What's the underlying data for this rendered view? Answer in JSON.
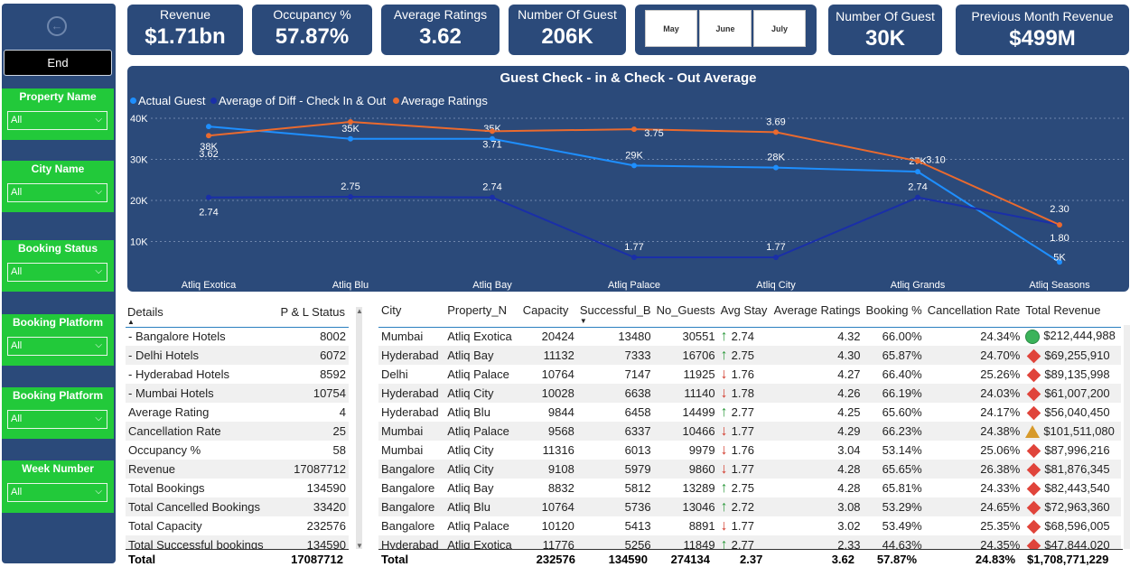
{
  "sidebar": {
    "end_label": "End",
    "slicers": [
      {
        "title": "Property Name",
        "value": "All"
      },
      {
        "title": "City Name",
        "value": "All"
      },
      {
        "title": "Booking Status",
        "value": "All"
      },
      {
        "title": "Booking Platform",
        "value": "All"
      },
      {
        "title": "Booking Platform",
        "value": "All"
      },
      {
        "title": "Week Number",
        "value": "All"
      }
    ]
  },
  "kpis": [
    {
      "label": "Revenue",
      "value": "$1.71bn"
    },
    {
      "label": "Occupancy %",
      "value": "57.87%"
    },
    {
      "label": "Average Ratings",
      "value": "3.62"
    },
    {
      "label": "Number Of Guest",
      "value": "206K"
    },
    {
      "label": "Number Of Guest",
      "value": "30K"
    },
    {
      "label": "Previous Month Revenue",
      "value": "$499M"
    }
  ],
  "months": [
    "May",
    "June",
    "July"
  ],
  "chart_data": {
    "type": "line",
    "title": "Guest Check - in & Check - Out Average",
    "categories": [
      "Atliq Exotica",
      "Atliq Blu",
      "Atliq Bay",
      "Atliq Palace",
      "Atliq City",
      "Atliq Grands",
      "Atliq Seasons"
    ],
    "y_ticks": [
      "40K",
      "30K",
      "20K",
      "10K"
    ],
    "ylim": [
      0,
      42000
    ],
    "series": [
      {
        "name": "Actual Guest",
        "color": "#1e8fff",
        "values": [
          38000,
          35000,
          35000,
          28500,
          28000,
          27000,
          5000
        ],
        "labels": [
          "38K",
          "35K",
          "35K",
          "29K",
          "28K",
          "27K",
          "5K"
        ]
      },
      {
        "name": "Average of Diff - Check In & Out",
        "color": "#1a2fa8",
        "values": [
          2.74,
          2.75,
          2.74,
          1.77,
          1.77,
          2.74,
          2.3
        ],
        "labels": [
          "2.74",
          "2.75",
          "2.74",
          "1.77",
          "1.77",
          "2.74",
          "2.30"
        ]
      },
      {
        "name": "Average Ratings",
        "color": "#ea6a2e",
        "values": [
          3.62,
          3.9,
          3.71,
          3.75,
          3.69,
          3.1,
          1.8
        ],
        "labels": [
          "3.62",
          "",
          "3.71",
          "3.75",
          "3.69",
          "3.10",
          "1.80"
        ]
      }
    ]
  },
  "left_table": {
    "headers": [
      "Details",
      "P & L Status"
    ],
    "rows": [
      [
        "- Bangalore Hotels",
        "8002"
      ],
      [
        "- Delhi Hotels",
        "6072"
      ],
      [
        "- Hyderabad Hotels",
        "8592"
      ],
      [
        "- Mumbai Hotels",
        "10754"
      ],
      [
        "Average Rating",
        "4"
      ],
      [
        "Cancellation Rate",
        "25"
      ],
      [
        "Occupancy %",
        "58"
      ],
      [
        "Revenue",
        "17087712"
      ],
      [
        "Total Bookings",
        "134590"
      ],
      [
        "Total Cancelled Bookings",
        "33420"
      ],
      [
        "Total Capacity",
        "232576"
      ],
      [
        "Total Successful bookings",
        "134590"
      ]
    ],
    "total": [
      "Total",
      "17087712"
    ]
  },
  "right_table": {
    "headers": [
      "City",
      "Property_N",
      "Capacity",
      "Successful_B",
      "No_Guests",
      "Avg Stay",
      "Average Ratings",
      "Booking %",
      "Cancellation Rate",
      "Total Revenue"
    ],
    "rows": [
      [
        "Mumbai",
        "Atliq Exotica",
        "20424",
        "13480",
        "30551",
        "up",
        "2.74",
        "4.32",
        "66.00%",
        "24.34%",
        "circle",
        "$212,444,988"
      ],
      [
        "Hyderabad",
        "Atliq Bay",
        "11132",
        "7333",
        "16706",
        "up",
        "2.75",
        "4.30",
        "65.87%",
        "24.70%",
        "diamond",
        "$69,255,910"
      ],
      [
        "Delhi",
        "Atliq Palace",
        "10764",
        "7147",
        "11925",
        "down",
        "1.76",
        "4.27",
        "66.40%",
        "25.26%",
        "diamond",
        "$89,135,998"
      ],
      [
        "Hyderabad",
        "Atliq City",
        "10028",
        "6638",
        "11140",
        "down",
        "1.78",
        "4.26",
        "66.19%",
        "24.03%",
        "diamond",
        "$61,007,200"
      ],
      [
        "Hyderabad",
        "Atliq Blu",
        "9844",
        "6458",
        "14499",
        "up",
        "2.77",
        "4.25",
        "65.60%",
        "24.17%",
        "diamond",
        "$56,040,450"
      ],
      [
        "Mumbai",
        "Atliq Palace",
        "9568",
        "6337",
        "10466",
        "down",
        "1.77",
        "4.29",
        "66.23%",
        "24.38%",
        "triangle",
        "$101,511,080"
      ],
      [
        "Mumbai",
        "Atliq City",
        "11316",
        "6013",
        "9979",
        "down",
        "1.76",
        "3.04",
        "53.14%",
        "25.06%",
        "diamond",
        "$87,996,216"
      ],
      [
        "Bangalore",
        "Atliq City",
        "9108",
        "5979",
        "9860",
        "down",
        "1.77",
        "4.28",
        "65.65%",
        "26.38%",
        "diamond",
        "$81,876,345"
      ],
      [
        "Bangalore",
        "Atliq Bay",
        "8832",
        "5812",
        "13289",
        "up",
        "2.75",
        "4.28",
        "65.81%",
        "24.33%",
        "diamond",
        "$82,443,540"
      ],
      [
        "Bangalore",
        "Atliq Blu",
        "10764",
        "5736",
        "13046",
        "up",
        "2.72",
        "3.08",
        "53.29%",
        "24.65%",
        "diamond",
        "$72,963,360"
      ],
      [
        "Bangalore",
        "Atliq Palace",
        "10120",
        "5413",
        "8891",
        "down",
        "1.77",
        "3.02",
        "53.49%",
        "25.35%",
        "diamond",
        "$68,596,005"
      ],
      [
        "Hyderabad",
        "Atliq Exotica",
        "11776",
        "5256",
        "11849",
        "up",
        "2.77",
        "2.33",
        "44.63%",
        "24.35%",
        "diamond",
        "$47,844,020"
      ]
    ],
    "total": [
      "Total",
      "",
      "232576",
      "134590",
      "274134",
      "2.37",
      "3.62",
      "57.87%",
      "24.83%",
      "$1,708,771,229"
    ]
  }
}
